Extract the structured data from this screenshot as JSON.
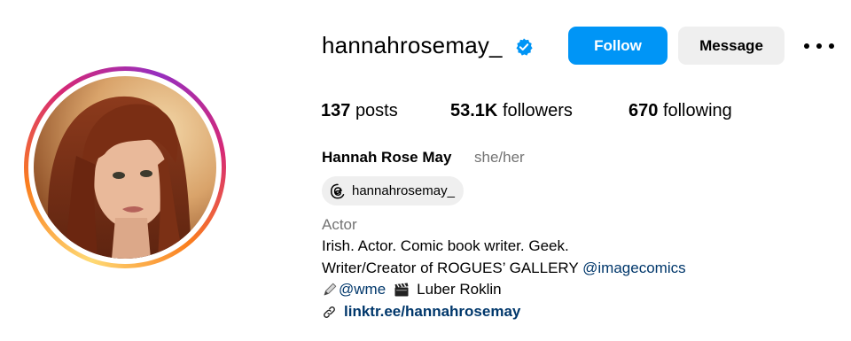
{
  "profile": {
    "username": "hannahrosemay_",
    "verified": true,
    "full_name": "Hannah Rose May",
    "pronouns": "she/her",
    "avatar_icon": "profile-photo"
  },
  "actions": {
    "follow_label": "Follow",
    "message_label": "Message",
    "more_icon": "more-options-icon"
  },
  "stats": {
    "posts_count": "137",
    "posts_label": "posts",
    "followers_count": "53.1K",
    "followers_label": "followers",
    "following_count": "670",
    "following_label": "following"
  },
  "threads": {
    "icon": "threads-icon",
    "handle": "hannahrosemay_"
  },
  "bio": {
    "category": "Actor",
    "line1": "Irish. Actor. Comic book writer. Geek.",
    "line2_text": "Writer/Creator of ROGUES’ GALLERY ",
    "line2_mention": "@imagecomics",
    "line3_mention": "@wme",
    "line3_text": "Luber Roklin",
    "link_icon": "link-icon",
    "link": "linktr.ee/hannahrosemay"
  },
  "colors": {
    "follow_button": "#0095f6",
    "message_button": "#efefef",
    "verified_badge": "#0095f6",
    "mention": "#00376b",
    "secondary_text": "#737373"
  }
}
